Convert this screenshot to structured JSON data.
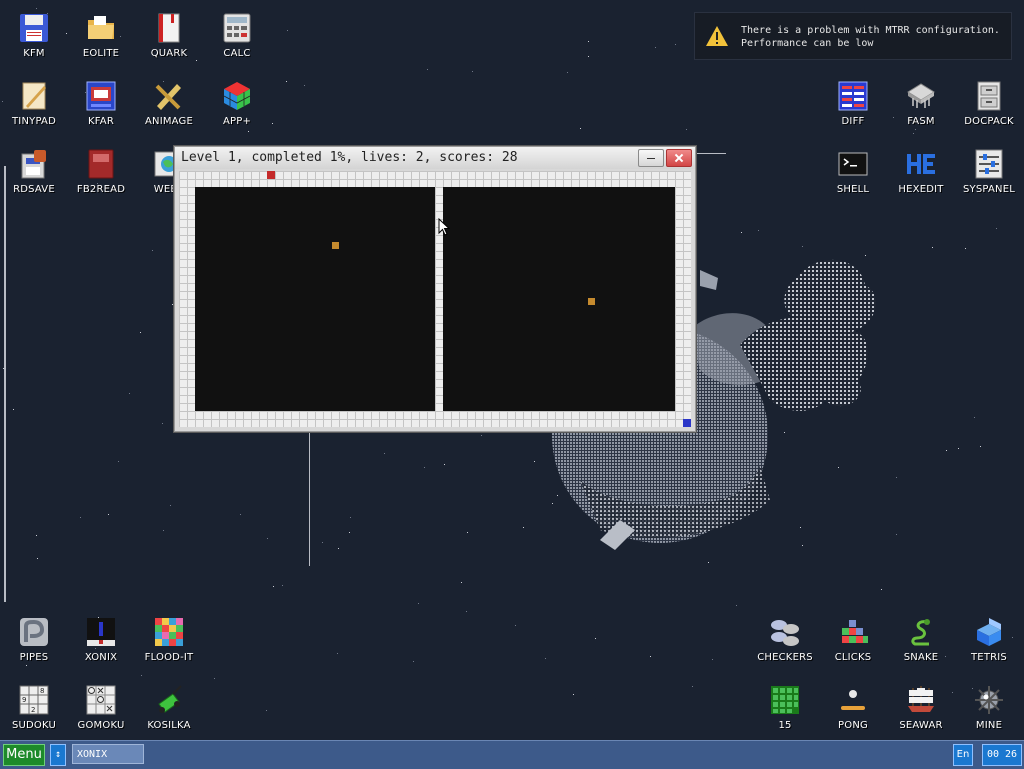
{
  "desktop": {
    "icons": [
      {
        "id": "kfm",
        "label": "KFM",
        "icon": "floppy-disk-icon"
      },
      {
        "id": "eolite",
        "label": "EOLITE",
        "icon": "folder-icon"
      },
      {
        "id": "quark",
        "label": "QUARK",
        "icon": "book-icon"
      },
      {
        "id": "calc",
        "label": "CALC",
        "icon": "calculator-icon"
      },
      {
        "id": "tinypad",
        "label": "TINYPAD",
        "icon": "notepad-icon"
      },
      {
        "id": "kfar",
        "label": "KFAR",
        "icon": "archive-window-icon"
      },
      {
        "id": "animage",
        "label": "ANIMAGE",
        "icon": "pencil-brush-icon"
      },
      {
        "id": "app-plus",
        "label": "APP+",
        "icon": "rubik-cube-icon"
      },
      {
        "id": "rdsave",
        "label": "RDSAVE",
        "icon": "save-disk-icon"
      },
      {
        "id": "fb2read",
        "label": "FB2READ",
        "icon": "fb2-book-icon"
      },
      {
        "id": "webv",
        "label": "WEBV",
        "icon": "web-image-icon"
      },
      {
        "id": "diff",
        "label": "DIFF",
        "icon": "diff-table-icon"
      },
      {
        "id": "fasm",
        "label": "FASM",
        "icon": "chip-icon"
      },
      {
        "id": "docpack",
        "label": "DOCPACK",
        "icon": "filing-cabinet-icon"
      },
      {
        "id": "shell",
        "label": "SHELL",
        "icon": "terminal-icon"
      },
      {
        "id": "hexedit",
        "label": "HEXEDIT",
        "icon": "hex-editor-icon"
      },
      {
        "id": "syspanel",
        "label": "SYSPANEL",
        "icon": "sliders-icon"
      },
      {
        "id": "pipes",
        "label": "PIPES",
        "icon": "pipes-icon"
      },
      {
        "id": "xonix",
        "label": "XONIX",
        "icon": "xonix-icon"
      },
      {
        "id": "flood-it",
        "label": "FLOOD-IT",
        "icon": "color-grid-icon"
      },
      {
        "id": "sudoku",
        "label": "SUDOKU",
        "icon": "sudoku-grid-icon"
      },
      {
        "id": "gomoku",
        "label": "GOMOKU",
        "icon": "tic-tac-toe-icon"
      },
      {
        "id": "kosilka",
        "label": "KOSILKA",
        "icon": "lawn-mower-icon"
      },
      {
        "id": "checkers",
        "label": "CHECKERS",
        "icon": "checkers-icon"
      },
      {
        "id": "clicks",
        "label": "CLICKS",
        "icon": "blocks-icon"
      },
      {
        "id": "snake",
        "label": "SNAKE",
        "icon": "snake-icon"
      },
      {
        "id": "tetris",
        "label": "TETRIS",
        "icon": "tetris-icon"
      },
      {
        "id": "fifteen",
        "label": "15",
        "icon": "fifteen-puzzle-icon"
      },
      {
        "id": "pong",
        "label": "PONG",
        "icon": "pong-icon"
      },
      {
        "id": "seawar",
        "label": "SEAWAR",
        "icon": "sailing-ship-icon"
      },
      {
        "id": "mine",
        "label": "MINE",
        "icon": "mine-icon"
      }
    ]
  },
  "notification": {
    "icon": "warning-icon",
    "line1": "There is a problem with MTRR configuration.",
    "line2": "Performance can be low"
  },
  "game_window": {
    "title": "Level 1, completed 1%, lives: 2, scores: 28",
    "level": 1,
    "completed_percent": 1,
    "lives": 2,
    "scores": 28,
    "colors": {
      "land": "#eeeeee",
      "sea": "#111111",
      "ball": "#c58a2e",
      "player": "#c42a2a",
      "land_enemy": "#2a36c8"
    }
  },
  "taskbar": {
    "menu_label": "Menu",
    "switch_icon": "arrows-updown-icon",
    "tasks": [
      {
        "label": "XONIX"
      }
    ],
    "language": "En",
    "clock": "00 26"
  }
}
